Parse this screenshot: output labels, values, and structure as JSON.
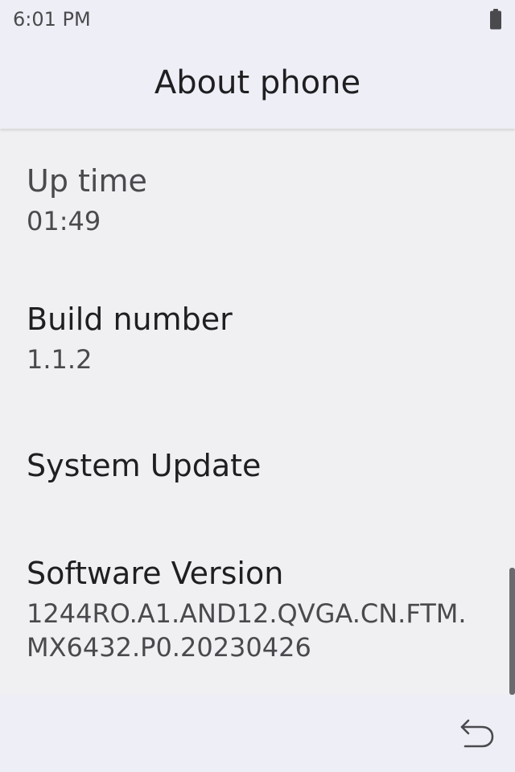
{
  "status_bar": {
    "time": "6:01 PM",
    "battery_icon": "battery-full-icon"
  },
  "app_bar": {
    "title": "About phone"
  },
  "items": [
    {
      "title": "Up time",
      "value": "01:49"
    },
    {
      "title": "Build number",
      "value": "1.1.2"
    },
    {
      "title": "System Update"
    },
    {
      "title": "Software Version",
      "value_lines": [
        "1244RO.A1.AND12.QVGA.CN.FTM.",
        "MX6432.P0.20230426"
      ]
    }
  ],
  "nav_bar": {
    "back_icon": "back-arrow-icon"
  },
  "colors": {
    "bar_background": "#eeeef6",
    "content_background": "#f0f0f2",
    "primary_text": "#1f1f22",
    "secondary_text": "#4a4a4e"
  }
}
